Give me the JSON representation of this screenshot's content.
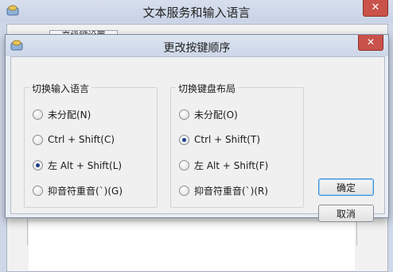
{
  "parent": {
    "title": "文本服务和输入语言",
    "close_glyph": "✕",
    "tab_label": "高级键设置"
  },
  "dialog": {
    "title": "更改按键顺序",
    "close_glyph": "✕",
    "input_language_group": {
      "legend": "切换输入语言",
      "options": [
        {
          "label": "未分配(N)",
          "checked": false
        },
        {
          "label": "Ctrl + Shift(C)",
          "checked": false
        },
        {
          "label": "左 Alt + Shift(L)",
          "checked": true
        },
        {
          "label": "抑音符重音(`)(G)",
          "checked": false
        }
      ]
    },
    "keyboard_layout_group": {
      "legend": "切换键盘布局",
      "options": [
        {
          "label": "未分配(O)",
          "checked": false
        },
        {
          "label": "Ctrl + Shift(T)",
          "checked": true
        },
        {
          "label": "左 Alt + Shift(F)",
          "checked": false
        },
        {
          "label": "抑音符重音(`)(R)",
          "checked": false
        }
      ]
    },
    "ok_label": "确定",
    "cancel_label": "取消"
  },
  "colors": {
    "close_button": "#c9524a",
    "default_button_border": "#3b8edc",
    "radio_dot": "#1f3f8f"
  },
  "icons": {
    "window_icon": "keyboard-icon",
    "close_icon": "close-icon"
  }
}
